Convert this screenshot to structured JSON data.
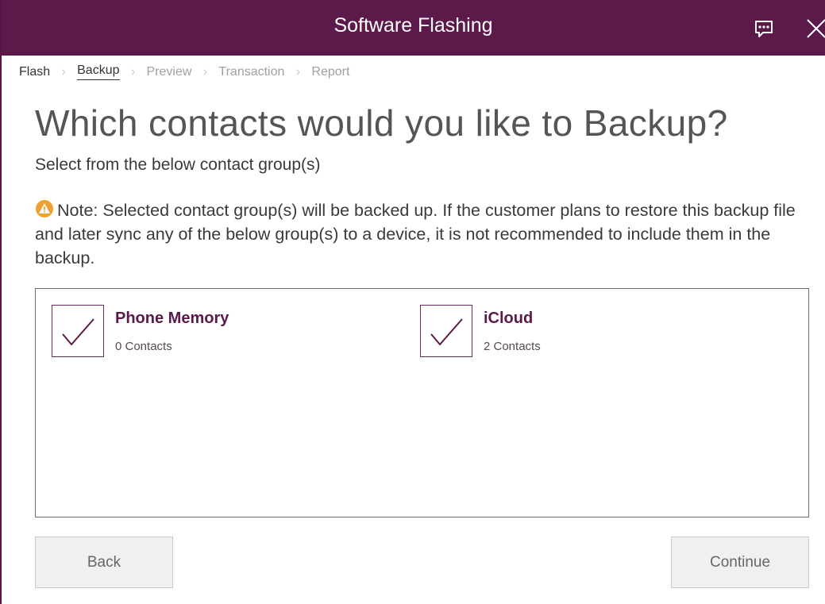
{
  "window": {
    "title": "Software Flashing",
    "chat_icon": "chat-bubble-icon",
    "close_icon": "close-icon"
  },
  "breadcrumb": {
    "items": [
      {
        "label": "Flash",
        "state": "done"
      },
      {
        "label": "Backup",
        "state": "active"
      },
      {
        "label": "Preview",
        "state": "pending"
      },
      {
        "label": "Transaction",
        "state": "pending"
      },
      {
        "label": "Report",
        "state": "pending"
      }
    ]
  },
  "main": {
    "heading": "Which contacts would you like to Backup?",
    "subheading": "Select from the below contact group(s)",
    "note": "Note: Selected contact group(s) will be backed up. If the customer plans to restore this backup file and later sync any of the below group(s) to a device, it is not recommended to include them in the backup.",
    "warning_icon": "warning-icon"
  },
  "groups": [
    {
      "name": "Phone Memory",
      "count": "0 Contacts",
      "checked": true
    },
    {
      "name": "iCloud",
      "count": "2 Contacts",
      "checked": true
    }
  ],
  "footer": {
    "back_label": "Back",
    "continue_label": "Continue"
  },
  "colors": {
    "brand": "#5b1a4a",
    "warning": "#f0a030"
  }
}
